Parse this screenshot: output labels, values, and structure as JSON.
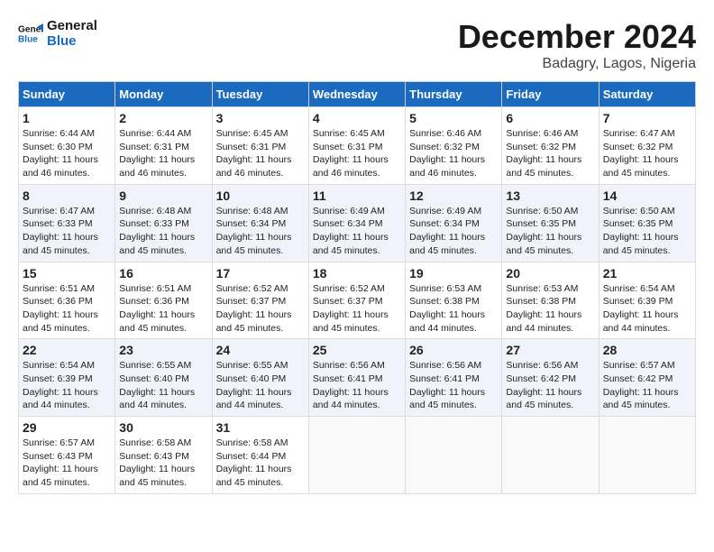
{
  "logo": {
    "line1": "General",
    "line2": "Blue"
  },
  "title": "December 2024",
  "location": "Badagry, Lagos, Nigeria",
  "days_of_week": [
    "Sunday",
    "Monday",
    "Tuesday",
    "Wednesday",
    "Thursday",
    "Friday",
    "Saturday"
  ],
  "weeks": [
    [
      {
        "day": "1",
        "sunrise": "6:44 AM",
        "sunset": "6:30 PM",
        "daylight": "11 hours and 46 minutes."
      },
      {
        "day": "2",
        "sunrise": "6:44 AM",
        "sunset": "6:31 PM",
        "daylight": "11 hours and 46 minutes."
      },
      {
        "day": "3",
        "sunrise": "6:45 AM",
        "sunset": "6:31 PM",
        "daylight": "11 hours and 46 minutes."
      },
      {
        "day": "4",
        "sunrise": "6:45 AM",
        "sunset": "6:31 PM",
        "daylight": "11 hours and 46 minutes."
      },
      {
        "day": "5",
        "sunrise": "6:46 AM",
        "sunset": "6:32 PM",
        "daylight": "11 hours and 46 minutes."
      },
      {
        "day": "6",
        "sunrise": "6:46 AM",
        "sunset": "6:32 PM",
        "daylight": "11 hours and 45 minutes."
      },
      {
        "day": "7",
        "sunrise": "6:47 AM",
        "sunset": "6:32 PM",
        "daylight": "11 hours and 45 minutes."
      }
    ],
    [
      {
        "day": "8",
        "sunrise": "6:47 AM",
        "sunset": "6:33 PM",
        "daylight": "11 hours and 45 minutes."
      },
      {
        "day": "9",
        "sunrise": "6:48 AM",
        "sunset": "6:33 PM",
        "daylight": "11 hours and 45 minutes."
      },
      {
        "day": "10",
        "sunrise": "6:48 AM",
        "sunset": "6:34 PM",
        "daylight": "11 hours and 45 minutes."
      },
      {
        "day": "11",
        "sunrise": "6:49 AM",
        "sunset": "6:34 PM",
        "daylight": "11 hours and 45 minutes."
      },
      {
        "day": "12",
        "sunrise": "6:49 AM",
        "sunset": "6:34 PM",
        "daylight": "11 hours and 45 minutes."
      },
      {
        "day": "13",
        "sunrise": "6:50 AM",
        "sunset": "6:35 PM",
        "daylight": "11 hours and 45 minutes."
      },
      {
        "day": "14",
        "sunrise": "6:50 AM",
        "sunset": "6:35 PM",
        "daylight": "11 hours and 45 minutes."
      }
    ],
    [
      {
        "day": "15",
        "sunrise": "6:51 AM",
        "sunset": "6:36 PM",
        "daylight": "11 hours and 45 minutes."
      },
      {
        "day": "16",
        "sunrise": "6:51 AM",
        "sunset": "6:36 PM",
        "daylight": "11 hours and 45 minutes."
      },
      {
        "day": "17",
        "sunrise": "6:52 AM",
        "sunset": "6:37 PM",
        "daylight": "11 hours and 45 minutes."
      },
      {
        "day": "18",
        "sunrise": "6:52 AM",
        "sunset": "6:37 PM",
        "daylight": "11 hours and 45 minutes."
      },
      {
        "day": "19",
        "sunrise": "6:53 AM",
        "sunset": "6:38 PM",
        "daylight": "11 hours and 44 minutes."
      },
      {
        "day": "20",
        "sunrise": "6:53 AM",
        "sunset": "6:38 PM",
        "daylight": "11 hours and 44 minutes."
      },
      {
        "day": "21",
        "sunrise": "6:54 AM",
        "sunset": "6:39 PM",
        "daylight": "11 hours and 44 minutes."
      }
    ],
    [
      {
        "day": "22",
        "sunrise": "6:54 AM",
        "sunset": "6:39 PM",
        "daylight": "11 hours and 44 minutes."
      },
      {
        "day": "23",
        "sunrise": "6:55 AM",
        "sunset": "6:40 PM",
        "daylight": "11 hours and 44 minutes."
      },
      {
        "day": "24",
        "sunrise": "6:55 AM",
        "sunset": "6:40 PM",
        "daylight": "11 hours and 44 minutes."
      },
      {
        "day": "25",
        "sunrise": "6:56 AM",
        "sunset": "6:41 PM",
        "daylight": "11 hours and 44 minutes."
      },
      {
        "day": "26",
        "sunrise": "6:56 AM",
        "sunset": "6:41 PM",
        "daylight": "11 hours and 45 minutes."
      },
      {
        "day": "27",
        "sunrise": "6:56 AM",
        "sunset": "6:42 PM",
        "daylight": "11 hours and 45 minutes."
      },
      {
        "day": "28",
        "sunrise": "6:57 AM",
        "sunset": "6:42 PM",
        "daylight": "11 hours and 45 minutes."
      }
    ],
    [
      {
        "day": "29",
        "sunrise": "6:57 AM",
        "sunset": "6:43 PM",
        "daylight": "11 hours and 45 minutes."
      },
      {
        "day": "30",
        "sunrise": "6:58 AM",
        "sunset": "6:43 PM",
        "daylight": "11 hours and 45 minutes."
      },
      {
        "day": "31",
        "sunrise": "6:58 AM",
        "sunset": "6:44 PM",
        "daylight": "11 hours and 45 minutes."
      },
      null,
      null,
      null,
      null
    ]
  ]
}
